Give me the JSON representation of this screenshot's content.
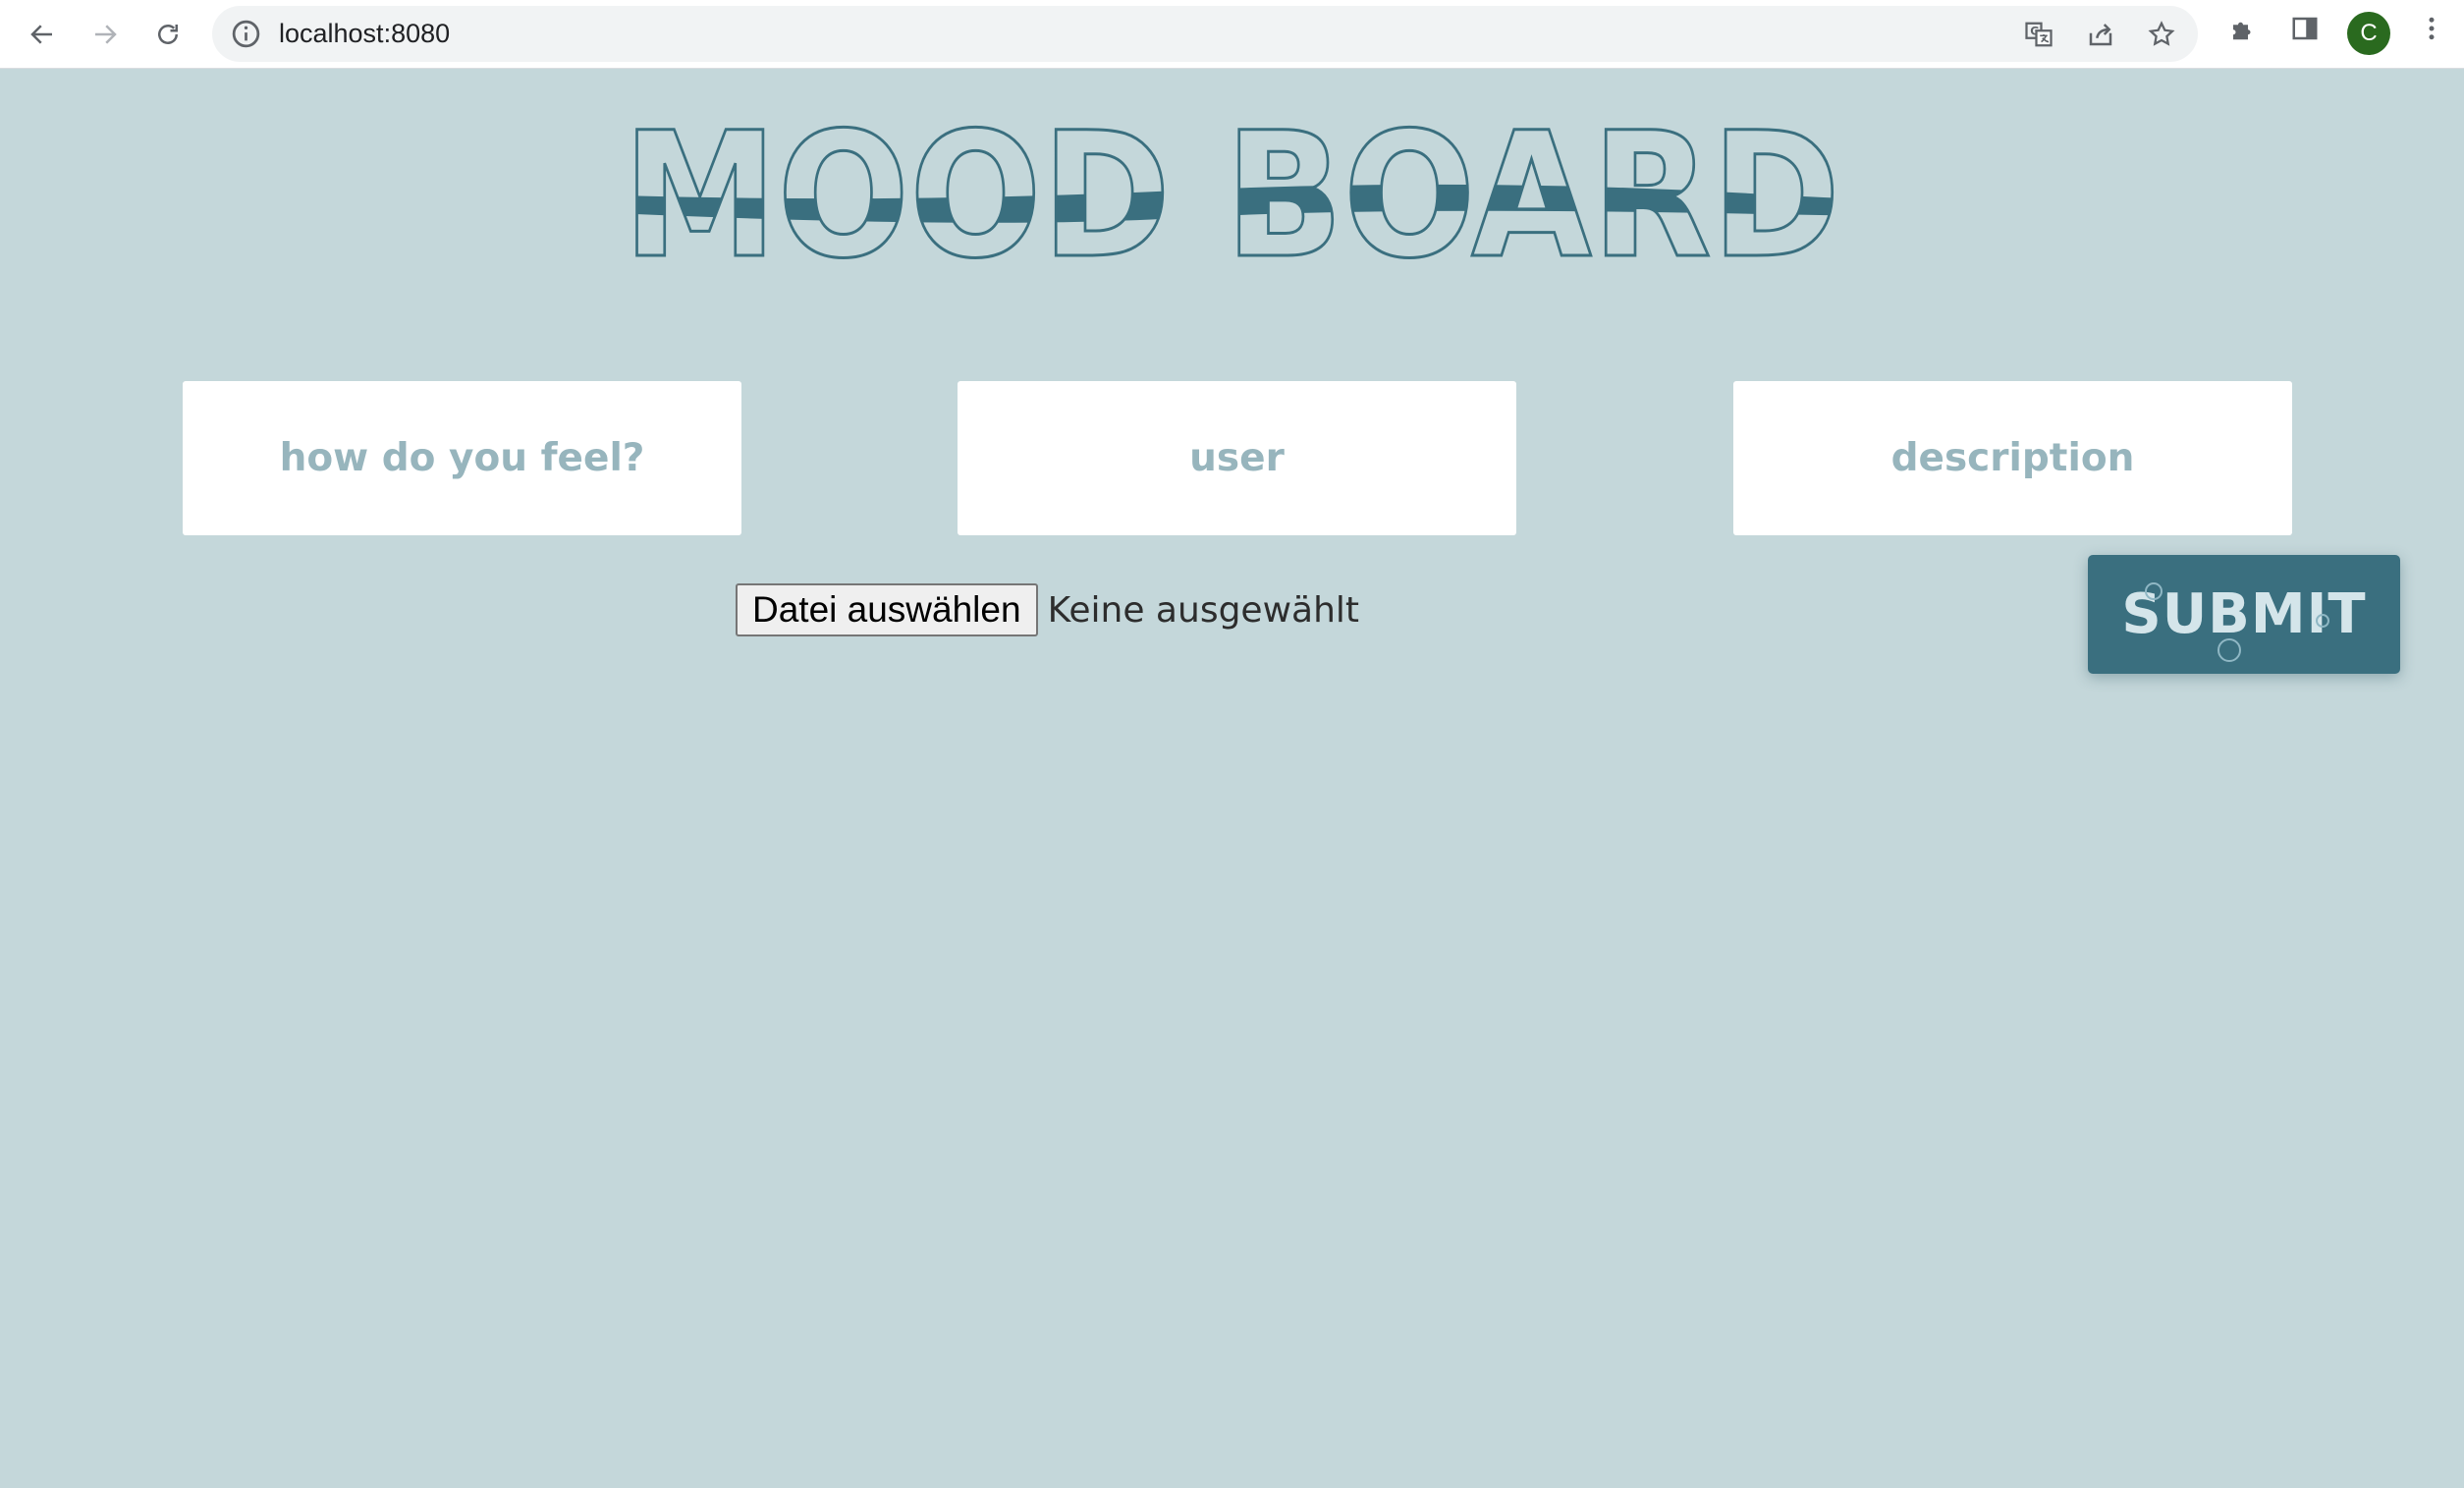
{
  "browser": {
    "url": "localhost:8080",
    "profile_initial": "C",
    "icons": {
      "back": "arrow-left-icon",
      "forward": "arrow-right-icon",
      "reload": "reload-icon",
      "site_info": "info-icon",
      "translate": "translate-icon",
      "share": "share-icon",
      "bookmark": "star-icon",
      "extensions": "puzzle-icon",
      "side_panel": "side-panel-icon",
      "menu": "kebab-menu-icon"
    }
  },
  "page": {
    "title": "MOOD BOARD",
    "colors": {
      "background": "#c4d7da",
      "accent": "#3a6f7f",
      "placeholder": "#97b5bd",
      "button_text": "#d4e5ea"
    },
    "fields": {
      "feeling_placeholder": "how do you feel?",
      "user_placeholder": "user",
      "description_placeholder": "description"
    },
    "file_input": {
      "button_label": "Datei auswählen",
      "status": "Keine ausgewählt"
    },
    "submit_label": "SUBMIT"
  }
}
